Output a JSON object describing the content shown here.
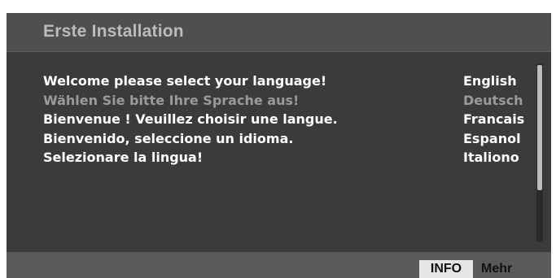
{
  "header": {
    "title": "Erste Installation"
  },
  "languages": [
    {
      "prompt": "Welcome please select your language!",
      "name": "English"
    },
    {
      "prompt": "Wählen Sie bitte Ihre Sprache aus!",
      "name": "Deutsch"
    },
    {
      "prompt": "Bienvenue ! Veuillez choisir une langue.",
      "name": "Francais"
    },
    {
      "prompt": "Bienvenido, seleccione un idioma.",
      "name": "Espanol"
    },
    {
      "prompt": "Selezionare la lingua!",
      "name": "Italiono"
    }
  ],
  "selected_language": "Deutsch",
  "footer": {
    "info_key": "INFO",
    "more_label": "Mehr"
  },
  "colors": {
    "panel_bg": "#3b3b3b",
    "title_bar_bg": "#4f4f4f",
    "selected_text": "#9a9a9a",
    "text": "#ffffff"
  }
}
